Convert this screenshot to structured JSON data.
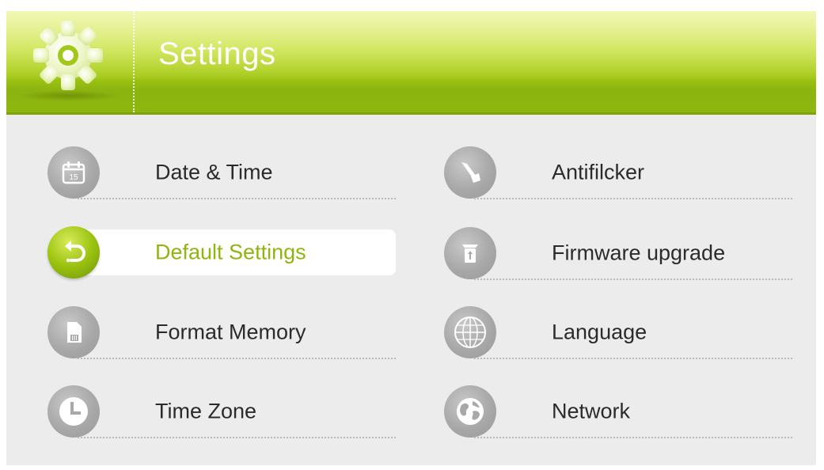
{
  "header": {
    "title": "Settings",
    "icon": "gear-icon"
  },
  "menu": {
    "left": [
      {
        "label": "Date & Time",
        "icon": "calendar-icon",
        "icon_text": "15"
      },
      {
        "label": "Default Settings",
        "icon": "undo-icon",
        "selected": true
      },
      {
        "label": "Format Memory",
        "icon": "sd-card-icon"
      },
      {
        "label": "Time Zone",
        "icon": "clock-icon"
      }
    ],
    "right": [
      {
        "label": "Antifilcker",
        "icon": "antifilcker-icon"
      },
      {
        "label": "Firmware upgrade",
        "icon": "firmware-upgrade-icon"
      },
      {
        "label": "Language",
        "icon": "globe-grid-icon"
      },
      {
        "label": "Network",
        "icon": "earth-icon"
      }
    ]
  },
  "colors": {
    "accent": "#9cc310",
    "selected_text": "#8fb60e",
    "background": "#ececec",
    "icon_gray": "#a8a8a8"
  }
}
